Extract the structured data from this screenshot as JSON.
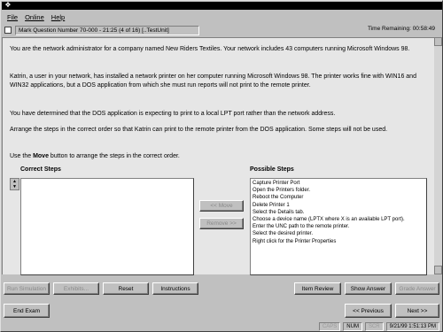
{
  "menu": [
    "File",
    "Online",
    "Help"
  ],
  "question": "Mark Question Number 70-000 - 21:25 (4 of 16) [..TestUnit]",
  "time_remaining_label": "Time Remaining: 00:58:49",
  "paragraphs": [
    "You are the network administrator for a company named New Riders Textiles. Your network includes 43 computers running Microsoft Windows 98.",
    "Katrin, a user in your network, has installed a network printer on her computer running Microsoft Windows 98. The printer works fine with WIN16 and WIN32 applications, but a DOS application from which she must run reports will not print to the remote printer.",
    "You have determined that the DOS application is expecting to print to a local LPT port rather than the network address.",
    "Arrange the steps in the correct order so that Katrin can print to the remote printer from the DOS application. Some steps will not be used."
  ],
  "instruction": {
    "before": "Use the ",
    "bold": "Move",
    "after": " button to arrange the steps in the correct order."
  },
  "correct_steps_heading": "Correct Steps",
  "possible_steps_heading": "Possible Steps",
  "possible_steps": [
    "Capture Printer Port",
    "Open the Printers folder.",
    "Reboot the Computer",
    "Delete Printer 1",
    "Select the Details tab.",
    "Choose a device name (LPTX where X is an available LPT port).",
    "Enter the UNC path to the remote printer.",
    "Select the desired printer.",
    "Right click for the Printer Properties"
  ],
  "move_button": "<< Move",
  "remove_button": "Remove >>",
  "bottom_buttons": {
    "run_simulation": "Run Simulation",
    "exhibits": "Exhibits...",
    "reset": "Reset",
    "instructions": "Instructions",
    "item_review": "Item Review",
    "show_answer": "Show Answer",
    "grade_answer": "Grade Answer"
  },
  "nav": {
    "end_exam": "End Exam",
    "previous": "<< Previous",
    "next": "Next >>"
  },
  "status": [
    "CAPS",
    "NUM",
    "SCR",
    "9/21/99 1:51:13 PM"
  ]
}
